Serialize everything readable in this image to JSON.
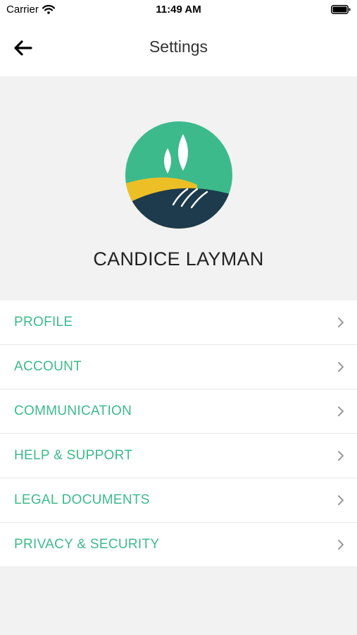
{
  "status_bar": {
    "carrier": "Carrier",
    "time": "11:49 AM"
  },
  "nav": {
    "title": "Settings"
  },
  "profile": {
    "name": "CANDICE LAYMAN",
    "logo_colors": {
      "sky": "#3dba8c",
      "field_yellow": "#ecbf26",
      "field_dark": "#1d3b4c",
      "leaf": "#ffffff"
    }
  },
  "menu": {
    "items": [
      {
        "label": "PROFILE"
      },
      {
        "label": "ACCOUNT"
      },
      {
        "label": "COMMUNICATION"
      },
      {
        "label": "HELP & SUPPORT"
      },
      {
        "label": "LEGAL DOCUMENTS"
      },
      {
        "label": "PRIVACY & SECURITY"
      }
    ],
    "accent_color": "#3dba8c",
    "chevron_color": "#9a9a9a"
  }
}
